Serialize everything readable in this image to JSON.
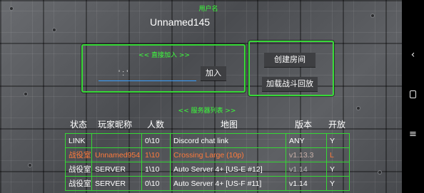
{
  "header": {
    "user_caption": "用户名",
    "username": "Unnamed145"
  },
  "join_panel": {
    "title": "<< 直接加入 >>",
    "ip_value": "",
    "ip_placeholder": "' : '",
    "join_label": "加入"
  },
  "actions": {
    "create_room_label": "创建房间",
    "load_replay_label": "加载战斗回放"
  },
  "server_list": {
    "title": "<< 服务器列表 >>",
    "columns": {
      "status": "状态",
      "player": "玩家昵称",
      "count": "人数",
      "map": "地图",
      "version": "版本",
      "open": "开放"
    },
    "rows": [
      {
        "status": "LINK",
        "player": "",
        "count": "0\\10",
        "map": "Discord chat link",
        "version": "ANY",
        "open": "Y"
      },
      {
        "status": "战役室",
        "player": "Unnamed954",
        "count": "1\\10",
        "map": "Crossing Large (10p)",
        "version": "v1.13.3",
        "open": "L"
      },
      {
        "status": "战役室",
        "player": "SERVER",
        "count": "1\\10",
        "map": "Auto Server 4+ [US-E #12]",
        "version": "v1.14",
        "open": "Y"
      },
      {
        "status": "战役室",
        "player": "SERVER",
        "count": "0\\10",
        "map": "Auto Server 4+ [US-F #11]",
        "version": "v1.14",
        "open": "Y"
      }
    ]
  },
  "nav": {
    "back_icon": "‹",
    "menu_icon": "≡"
  },
  "colors": {
    "accent_green": "#37d937",
    "highlight_row": "#ff7a3c",
    "input_underline": "#3aa0ff"
  }
}
